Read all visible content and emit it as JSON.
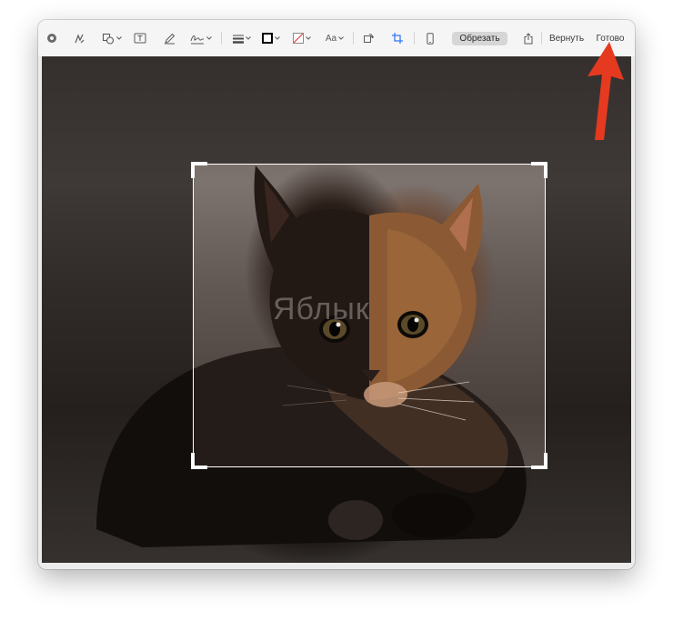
{
  "toolbar": {
    "tools": [
      {
        "name": "markup-icon"
      },
      {
        "name": "sketch-icon"
      },
      {
        "name": "shapes-icon"
      },
      {
        "name": "text-box-icon"
      },
      {
        "name": "draw-icon"
      },
      {
        "name": "signature-icon"
      },
      {
        "name": "line-style-icon"
      },
      {
        "name": "border-color-icon"
      },
      {
        "name": "fill-color-icon"
      },
      {
        "name": "text-style-icon"
      },
      {
        "name": "rotate-icon"
      },
      {
        "name": "crop-icon"
      },
      {
        "name": "device-icon"
      },
      {
        "name": "share-icon"
      }
    ],
    "text_style_label": "Aa",
    "crop_button": "Обрезать",
    "revert_button": "Вернуть",
    "done_button": "Готово"
  },
  "watermark": "Яблык",
  "colors": {
    "accent": "#3478f6",
    "arrow": "#e53a1f",
    "crop_border": "#ffffff",
    "border_swatch": "#000000",
    "fill_swatch_slash": "#e0424a"
  }
}
